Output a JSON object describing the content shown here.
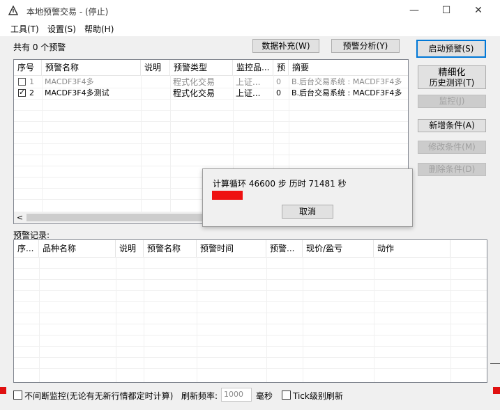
{
  "window": {
    "title": "本地预警交易 - (停止)",
    "minimize_glyph": "—",
    "maximize_glyph": "☐",
    "close_glyph": "✕"
  },
  "menu": [
    "工具(T)",
    "设置(S)",
    "帮助(H)"
  ],
  "top": {
    "count_text": "共有 0 个预警",
    "data_fill_button": "数据补充(W)",
    "alert_analysis_button": "预警分析(Y)"
  },
  "alerts_table": {
    "columns": [
      "序号",
      "预警名称",
      "说明",
      "预警类型",
      "监控品...",
      "预",
      "摘要"
    ],
    "rows": [
      {
        "checked": false,
        "index": "1",
        "name": "MACDF3F4多",
        "desc": "",
        "type": "程式化交易",
        "monitor": "上证...",
        "pre": "0",
        "summary": "B.后台交易系统 : MACDF3F4多",
        "dim": true
      },
      {
        "checked": true,
        "index": "2",
        "name": "MACDF3F4多测试",
        "desc": "",
        "type": "程式化交易",
        "monitor": "上证...",
        "pre": "0",
        "summary": "B.后台交易系统 : MACDF3F4多",
        "dim": false
      }
    ],
    "scroll_left_glyph": "<"
  },
  "right_buttons": {
    "start_alert": "启动预警(S)",
    "backtest_line1": "精细化",
    "backtest_line2": "历史测评(T)",
    "monitor": "监控(J)",
    "add_condition": "新增条件(A)",
    "modify_condition": "修改条件(M)",
    "delete_condition": "删除条件(D)"
  },
  "dialog": {
    "label_calc": "计算循环",
    "steps": "46600",
    "label_steps": "步",
    "label_elapsed": "历时",
    "seconds": "71481",
    "label_seconds": "秒",
    "cancel": "取消",
    "bar_color": "#ee1111"
  },
  "records": {
    "label": "预警记录:",
    "columns": [
      "序...",
      "品种名称",
      "说明",
      "预警名称",
      "预警时间",
      "预警...",
      "现价/盈亏",
      "动作"
    ]
  },
  "bottom": {
    "continuous_label": "不间断监控(无论有无新行情都定时计算)",
    "refresh_label": "刷新频率:",
    "refresh_value": "1000",
    "ms_label": "毫秒",
    "tick_label": "Tick级别刷新"
  }
}
